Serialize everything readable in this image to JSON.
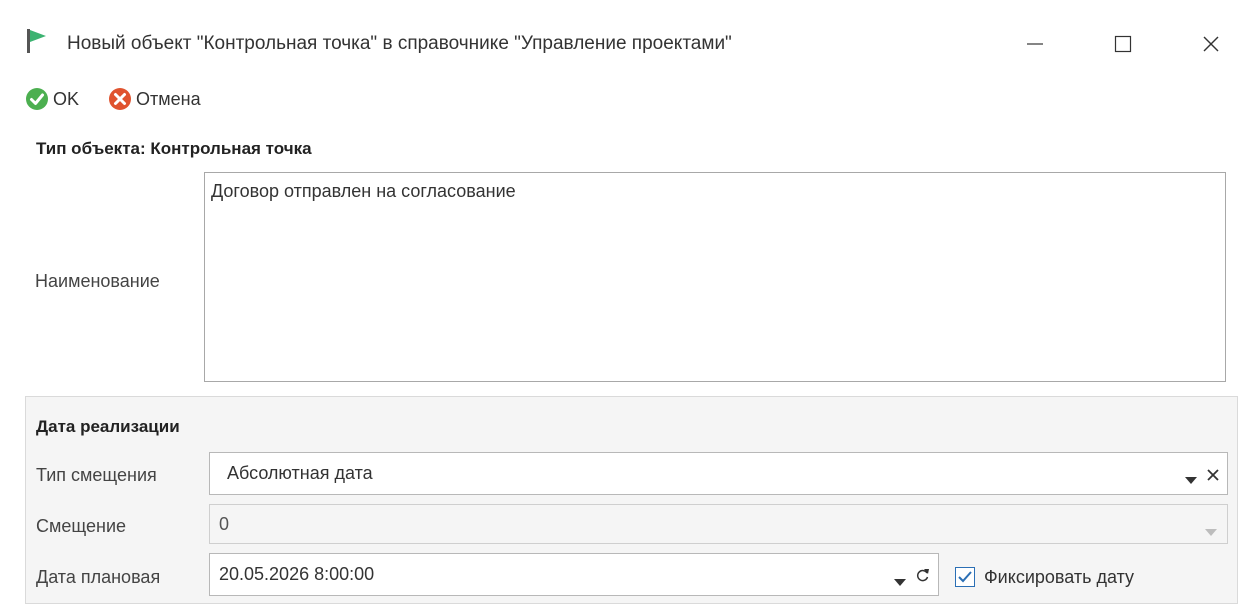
{
  "window": {
    "title": "Новый объект \"Контрольная точка\" в справочнике \"Управление проектами\"",
    "icon": "flag-icon",
    "controls": [
      "minimize-icon",
      "maximize-icon",
      "close-icon"
    ]
  },
  "toolbar": {
    "ok_label": "OK",
    "cancel_label": "Отмена",
    "ok_color": "#4caf50",
    "cancel_color": "#e0532f"
  },
  "object_type": "Тип объекта: Контрольная точка",
  "name_field": {
    "label": "Наименование",
    "value": "Договор отправлен на согласование"
  },
  "date_group": {
    "title": "Дата реализации",
    "offset_type": {
      "label": "Тип смещения",
      "value": "Абсолютная дата"
    },
    "offset": {
      "label": "Смещение",
      "value": "0",
      "disabled": true
    },
    "planned_date": {
      "label": "Дата плановая",
      "value": "20.05.2026 8:00:00"
    },
    "fix_date": {
      "label": "Фиксировать дату",
      "checked": true
    }
  },
  "colors": {
    "accent": "#2b6fb5",
    "flag": "#3cb371"
  }
}
